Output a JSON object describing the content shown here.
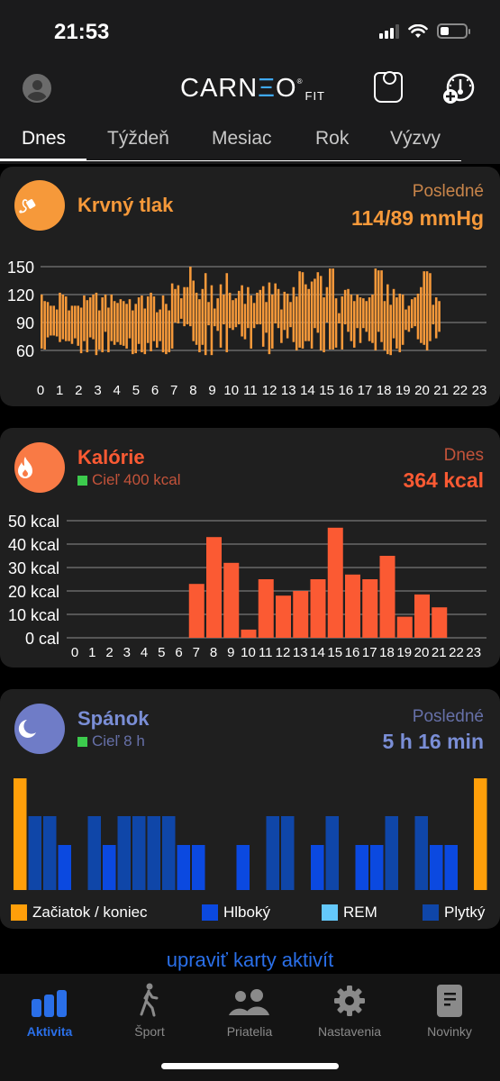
{
  "status_bar": {
    "time": "21:53"
  },
  "header": {
    "logo_text": "CARN",
    "logo_e": "Ξ",
    "logo_o": "O",
    "logo_sub": "FIT",
    "logo_reg": "®"
  },
  "tabs": [
    {
      "label": "Dnes",
      "active": true
    },
    {
      "label": "Týždeň",
      "active": false
    },
    {
      "label": "Mesiac",
      "active": false
    },
    {
      "label": "Rok",
      "active": false
    },
    {
      "label": "Výzvy",
      "active": false
    }
  ],
  "colors": {
    "bp": "#f6993a",
    "calories": "#fb5a33",
    "sleep_accent": "#7884c8",
    "sleep_icon_bg": "#6f7cc7",
    "bp_icon_bg": "#f6993a",
    "cal_icon_bg": "#f97a45",
    "goal": "#3ccb4d",
    "start_end": "#ff9f0a",
    "deep": "#0b49e0",
    "rem": "#64c8fa",
    "light": "#0f46a8",
    "link": "#2a6fe8"
  },
  "cards": {
    "blood_pressure": {
      "title": "Krvný tlak",
      "label": "Posledné",
      "value": "114/89 mmHg"
    },
    "calories": {
      "title": "Kalórie",
      "goal": "Cieľ 400 kcal",
      "label": "Dnes",
      "value": "364 kcal"
    },
    "sleep": {
      "title": "Spánok",
      "goal": "Cieľ 8 h",
      "label": "Posledné",
      "value": "5 h 16 min",
      "legend": [
        {
          "label": "Začiatok / koniec",
          "key": "start_end"
        },
        {
          "label": "Hlboký",
          "key": "deep"
        },
        {
          "label": "REM",
          "key": "rem"
        },
        {
          "label": "Plytký",
          "key": "light"
        }
      ]
    }
  },
  "edit_link": "upraviť karty aktivít",
  "tabbar": [
    {
      "label": "Aktivita",
      "icon": "activity-bars-icon",
      "active": true
    },
    {
      "label": "Šport",
      "icon": "walking-person-icon",
      "active": false
    },
    {
      "label": "Priatelia",
      "icon": "friends-icon",
      "active": false
    },
    {
      "label": "Nastavenia",
      "icon": "gear-icon",
      "active": false
    },
    {
      "label": "Novinky",
      "icon": "news-document-icon",
      "active": false
    }
  ],
  "chart_data": [
    {
      "type": "bar",
      "title": "Krvný tlak",
      "subtype": "range",
      "xlabel": "hour",
      "ylabel": "mmHg",
      "ylim": [
        60,
        150
      ],
      "yticks": [
        150,
        120,
        90,
        60
      ],
      "xticks": [
        "0",
        "1",
        "2",
        "3",
        "4",
        "5",
        "6",
        "7",
        "8",
        "9",
        "10",
        "11",
        "12",
        "13",
        "14",
        "15",
        "16",
        "17",
        "18",
        "19",
        "20",
        "21",
        "22",
        "23"
      ],
      "x_range": [
        0,
        23
      ],
      "grid": true,
      "readings_start_hour": 0,
      "readings_end_hour": 21,
      "series": [
        {
          "name": "systolic",
          "values": [
            120,
            113,
            112,
            108,
            108,
            104,
            122,
            120,
            118,
            103,
            108,
            108,
            108,
            106,
            119,
            114,
            117,
            120,
            122,
            103,
            117,
            120,
            106,
            120,
            113,
            111,
            115,
            113,
            110,
            115,
            103,
            110,
            117,
            119,
            105,
            118,
            122,
            118,
            101,
            104,
            119,
            110,
            103,
            132,
            126,
            130,
            116,
            128,
            128,
            150,
            135,
            122,
            115,
            126,
            143,
            112,
            130,
            105,
            116,
            131,
            120,
            143,
            122,
            114,
            116,
            124,
            130,
            110,
            128,
            119,
            111,
            122,
            125,
            129,
            112,
            133,
            120,
            132,
            126,
            104,
            123,
            121,
            112,
            128,
            118,
            145,
            144,
            131,
            126,
            134,
            137,
            144,
            140,
            117,
            128,
            148,
            148,
            116,
            100,
            118,
            125,
            126,
            120,
            113,
            120,
            117,
            116,
            113,
            117,
            120,
            148,
            146,
            146,
            113,
            131,
            109,
            126,
            117,
            121,
            120,
            104,
            108,
            115,
            117,
            121,
            128,
            145,
            145,
            143,
            109,
            117,
            113
          ]
        },
        {
          "name": "diastolic",
          "values": [
            62,
            61,
            74,
            76,
            76,
            75,
            69,
            72,
            70,
            70,
            67,
            73,
            65,
            57,
            70,
            58,
            74,
            72,
            55,
            61,
            58,
            80,
            58,
            70,
            66,
            69,
            66,
            65,
            62,
            73,
            56,
            57,
            67,
            58,
            56,
            68,
            59,
            70,
            63,
            70,
            58,
            56,
            58,
            62,
            90,
            89,
            94,
            86,
            88,
            86,
            70,
            66,
            58,
            66,
            55,
            87,
            55,
            86,
            81,
            63,
            88,
            58,
            84,
            82,
            85,
            88,
            75,
            72,
            84,
            62,
            84,
            88,
            88,
            64,
            79,
            56,
            62,
            89,
            84,
            68,
            82,
            73,
            85,
            69,
            60,
            63,
            62,
            70,
            70,
            62,
            84,
            79,
            60,
            58,
            90,
            61,
            61,
            63,
            89,
            61,
            88,
            80,
            70,
            63,
            84,
            68,
            84,
            80,
            70,
            68,
            60,
            80,
            69,
            60,
            56,
            55,
            73,
            62,
            58,
            66,
            82,
            80,
            84,
            86,
            72,
            68,
            66,
            60,
            70,
            88,
            73,
            80
          ]
        }
      ]
    },
    {
      "type": "bar",
      "title": "Kalórie",
      "ylabel": "kcal",
      "ylim": [
        0,
        50
      ],
      "yticks": [
        "50 kcal",
        "40 kcal",
        "30 kcal",
        "20 kcal",
        "10 kcal",
        "0 cal"
      ],
      "categories": [
        "0",
        "1",
        "2",
        "3",
        "4",
        "5",
        "6",
        "7",
        "8",
        "9",
        "10",
        "11",
        "12",
        "13",
        "14",
        "15",
        "16",
        "17",
        "18",
        "19",
        "20",
        "21",
        "22",
        "23"
      ],
      "values": [
        0,
        0,
        0,
        0,
        0,
        0,
        0,
        23,
        43,
        32,
        3.5,
        25,
        18,
        20,
        25,
        47,
        27,
        25,
        35,
        9,
        18.5,
        13,
        0,
        0
      ],
      "grid": true
    },
    {
      "type": "bar",
      "title": "Spánok",
      "legend_position": "bottom",
      "stage_levels": {
        "start_end": 3,
        "light": 2,
        "deep": 1,
        "rem": 1.5
      },
      "segments": [
        "start_end",
        "light",
        "light",
        "deep",
        "",
        "light",
        "deep",
        "light",
        "light",
        "light",
        "light",
        "deep",
        "deep",
        "",
        "",
        "deep",
        "",
        "light",
        "light",
        "",
        "deep",
        "light",
        "",
        "deep",
        "deep",
        "light",
        "",
        "light",
        "deep",
        "deep",
        "start_end"
      ]
    }
  ]
}
